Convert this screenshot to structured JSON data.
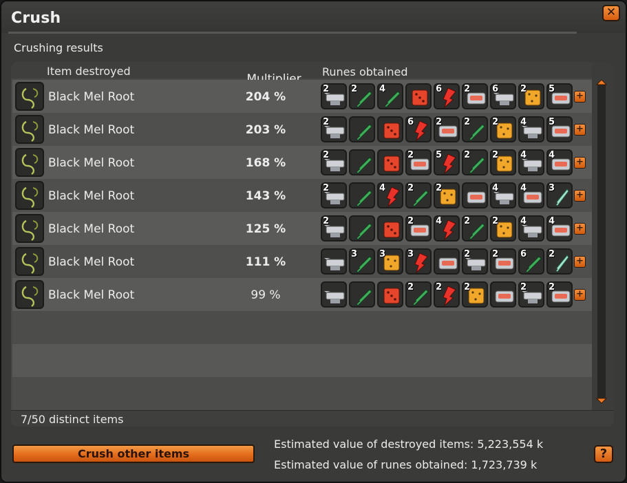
{
  "window": {
    "title": "Crush",
    "close_label": "✕"
  },
  "section_title": "Crushing results",
  "table": {
    "headers": {
      "item": "Item destroyed",
      "multiplier": "Multiplier",
      "runes": "Runes obtained"
    },
    "rows": [
      {
        "item": "Black Mel Root",
        "multiplier": "204 %",
        "bold": true,
        "runes": [
          {
            "type": "anvil",
            "count": "2"
          },
          {
            "type": "sword",
            "count": "2"
          },
          {
            "type": "sword",
            "count": "4"
          },
          {
            "type": "die",
            "count": ""
          },
          {
            "type": "bolt",
            "count": "6"
          },
          {
            "type": "chest",
            "count": "2"
          },
          {
            "type": "anvil",
            "count": "6"
          },
          {
            "type": "gold",
            "count": "2"
          },
          {
            "type": "chest",
            "count": "5"
          }
        ]
      },
      {
        "item": "Black Mel Root",
        "multiplier": "203 %",
        "bold": true,
        "runes": [
          {
            "type": "anvil",
            "count": "2"
          },
          {
            "type": "sword",
            "count": ""
          },
          {
            "type": "die",
            "count": ""
          },
          {
            "type": "bolt",
            "count": "6"
          },
          {
            "type": "chest",
            "count": "2"
          },
          {
            "type": "sword",
            "count": "2"
          },
          {
            "type": "gold",
            "count": "2"
          },
          {
            "type": "anvil",
            "count": "4"
          },
          {
            "type": "chest",
            "count": "5"
          }
        ]
      },
      {
        "item": "Black Mel Root",
        "multiplier": "168 %",
        "bold": true,
        "runes": [
          {
            "type": "anvil",
            "count": "2"
          },
          {
            "type": "sword",
            "count": ""
          },
          {
            "type": "die",
            "count": ""
          },
          {
            "type": "chest",
            "count": "2"
          },
          {
            "type": "bolt",
            "count": "5"
          },
          {
            "type": "sword",
            "count": "2"
          },
          {
            "type": "gold",
            "count": "2"
          },
          {
            "type": "anvil",
            "count": "4"
          },
          {
            "type": "chest",
            "count": "4"
          }
        ]
      },
      {
        "item": "Black Mel Root",
        "multiplier": "143 %",
        "bold": true,
        "runes": [
          {
            "type": "anvil",
            "count": "2"
          },
          {
            "type": "sword",
            "count": ""
          },
          {
            "type": "bolt",
            "count": "4"
          },
          {
            "type": "sword",
            "count": "2"
          },
          {
            "type": "gold",
            "count": "2"
          },
          {
            "type": "chest",
            "count": ""
          },
          {
            "type": "anvil",
            "count": "4"
          },
          {
            "type": "chest",
            "count": "4"
          },
          {
            "type": "knife",
            "count": "3"
          }
        ]
      },
      {
        "item": "Black Mel Root",
        "multiplier": "125 %",
        "bold": true,
        "runes": [
          {
            "type": "anvil",
            "count": "2"
          },
          {
            "type": "sword",
            "count": ""
          },
          {
            "type": "die",
            "count": ""
          },
          {
            "type": "chest",
            "count": "2"
          },
          {
            "type": "bolt",
            "count": "4"
          },
          {
            "type": "sword",
            "count": "2"
          },
          {
            "type": "gold",
            "count": "2"
          },
          {
            "type": "anvil",
            "count": "4"
          },
          {
            "type": "chest",
            "count": "4"
          }
        ]
      },
      {
        "item": "Black Mel Root",
        "multiplier": "111 %",
        "bold": true,
        "runes": [
          {
            "type": "anvil",
            "count": ""
          },
          {
            "type": "sword",
            "count": "3"
          },
          {
            "type": "gold",
            "count": "3"
          },
          {
            "type": "bolt",
            "count": "3"
          },
          {
            "type": "chest",
            "count": ""
          },
          {
            "type": "anvil",
            "count": "2"
          },
          {
            "type": "chest",
            "count": "2"
          },
          {
            "type": "sword",
            "count": "6"
          },
          {
            "type": "knife",
            "count": "2"
          }
        ]
      },
      {
        "item": "Black Mel Root",
        "multiplier": "99 %",
        "bold": false,
        "runes": [
          {
            "type": "anvil",
            "count": ""
          },
          {
            "type": "sword",
            "count": ""
          },
          {
            "type": "die",
            "count": ""
          },
          {
            "type": "sword",
            "count": "2"
          },
          {
            "type": "bolt",
            "count": "2"
          },
          {
            "type": "gold",
            "count": "2"
          },
          {
            "type": "chest",
            "count": ""
          },
          {
            "type": "anvil",
            "count": "2"
          },
          {
            "type": "chest",
            "count": "2"
          }
        ]
      }
    ],
    "plus_label": "+"
  },
  "footer": {
    "distinct_items": "7/50 distinct items"
  },
  "actions": {
    "crush_label": "Crush other items",
    "help_label": "?"
  },
  "estimates": {
    "destroyed": "Estimated value of destroyed items: 5,223,554 k",
    "runes": "Estimated value of runes obtained: 1,723,739 k"
  },
  "colors": {
    "accent": "#e8711f",
    "panel": "#484846",
    "row_odd": "#5a5a58",
    "row_even": "#4f4f4d"
  }
}
